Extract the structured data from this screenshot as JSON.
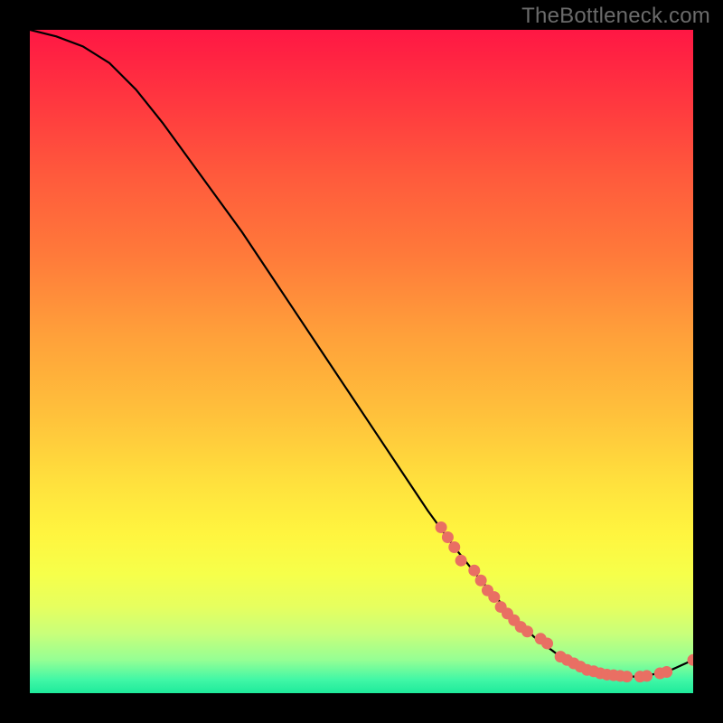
{
  "watermark": {
    "text": "TheBottleneck.com"
  },
  "colors": {
    "background": "#000000",
    "curve": "#000000",
    "marker": "#e96f63",
    "gradient_top": "#ff1744",
    "gradient_bottom": "#1eea9b"
  },
  "chart_data": {
    "type": "line",
    "title": "",
    "xlabel": "",
    "ylabel": "",
    "xlim": [
      0,
      100
    ],
    "ylim": [
      0,
      100
    ],
    "grid": false,
    "legend": false,
    "series": [
      {
        "name": "curve",
        "x": [
          0,
          4,
          8,
          12,
          16,
          20,
          24,
          28,
          32,
          36,
          40,
          44,
          48,
          52,
          56,
          60,
          64,
          68,
          72,
          76,
          80,
          84,
          88,
          92,
          96,
          100
        ],
        "y": [
          100,
          99,
          97.5,
          95,
          91,
          86,
          80.5,
          75,
          69.5,
          63.5,
          57.5,
          51.5,
          45.5,
          39.5,
          33.5,
          27.5,
          22,
          17,
          12.5,
          8.5,
          5.5,
          3.5,
          2.5,
          2.5,
          3.2,
          5
        ]
      }
    ],
    "markers": [
      {
        "x": 62,
        "y": 25.0
      },
      {
        "x": 63,
        "y": 23.5
      },
      {
        "x": 64,
        "y": 22.0
      },
      {
        "x": 65,
        "y": 20.0
      },
      {
        "x": 67,
        "y": 18.5
      },
      {
        "x": 68,
        "y": 17.0
      },
      {
        "x": 69,
        "y": 15.5
      },
      {
        "x": 70,
        "y": 14.5
      },
      {
        "x": 71,
        "y": 13.0
      },
      {
        "x": 72,
        "y": 12.0
      },
      {
        "x": 73,
        "y": 11.0
      },
      {
        "x": 74,
        "y": 10.0
      },
      {
        "x": 75,
        "y": 9.3
      },
      {
        "x": 77,
        "y": 8.2
      },
      {
        "x": 78,
        "y": 7.5
      },
      {
        "x": 80,
        "y": 5.5
      },
      {
        "x": 81,
        "y": 5.0
      },
      {
        "x": 82,
        "y": 4.5
      },
      {
        "x": 83,
        "y": 4.0
      },
      {
        "x": 84,
        "y": 3.5
      },
      {
        "x": 85,
        "y": 3.3
      },
      {
        "x": 86,
        "y": 3.0
      },
      {
        "x": 87,
        "y": 2.8
      },
      {
        "x": 88,
        "y": 2.7
      },
      {
        "x": 89,
        "y": 2.6
      },
      {
        "x": 90,
        "y": 2.5
      },
      {
        "x": 92,
        "y": 2.5
      },
      {
        "x": 93,
        "y": 2.6
      },
      {
        "x": 95,
        "y": 3.0
      },
      {
        "x": 96,
        "y": 3.2
      },
      {
        "x": 100,
        "y": 5.0
      }
    ]
  }
}
